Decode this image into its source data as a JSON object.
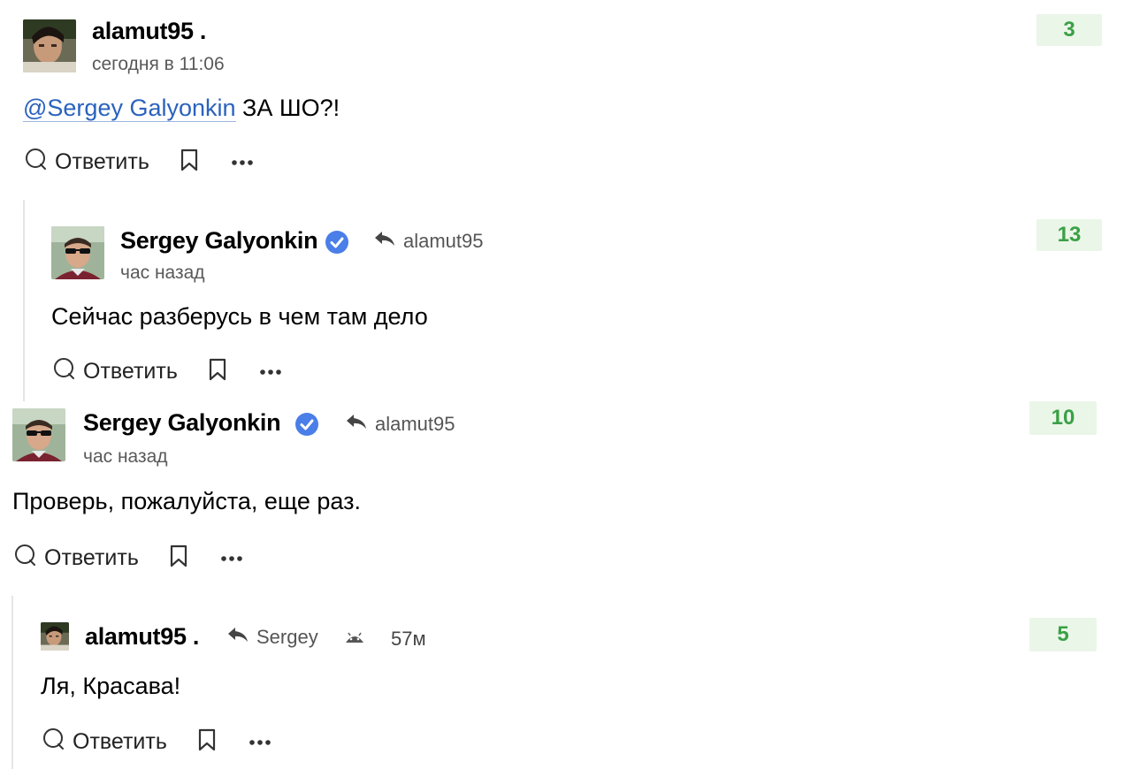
{
  "colors": {
    "mention": "#2a62bd",
    "score_bg": "#eaf6e8",
    "score_text": "#3aa046",
    "verified": "#4a7ee8"
  },
  "comments": [
    {
      "author": "alamut95 .",
      "time": "сегодня в 11:06",
      "mention": "@Sergey Galyonkin",
      "text": " ЗА ШО?!",
      "score": "3",
      "reply_label": "Ответить"
    },
    {
      "author": "Sergey Galyonkin",
      "verified": true,
      "reply_to": "alamut95",
      "time": "час назад",
      "text": "Сейчас разберусь в чем там дело",
      "score": "13",
      "reply_label": "Ответить"
    },
    {
      "author": "Sergey Galyonkin",
      "verified": true,
      "reply_to": "alamut95",
      "time": "час назад",
      "text": "Проверь, пожалуйста, еще раз.",
      "score": "10",
      "reply_label": "Ответить"
    },
    {
      "author": "alamut95 .",
      "reply_to": "Sergey",
      "platform_icon": "android-icon",
      "time": "57м",
      "text": "Ля, Красава!",
      "score": "5",
      "reply_label": "Ответить"
    }
  ],
  "icons": {
    "reply": "speech-bubble-icon",
    "bookmark": "bookmark-icon",
    "more": "more-dots-icon",
    "reply_arrow": "reply-arrow-icon",
    "verified": "verified-badge-icon"
  }
}
